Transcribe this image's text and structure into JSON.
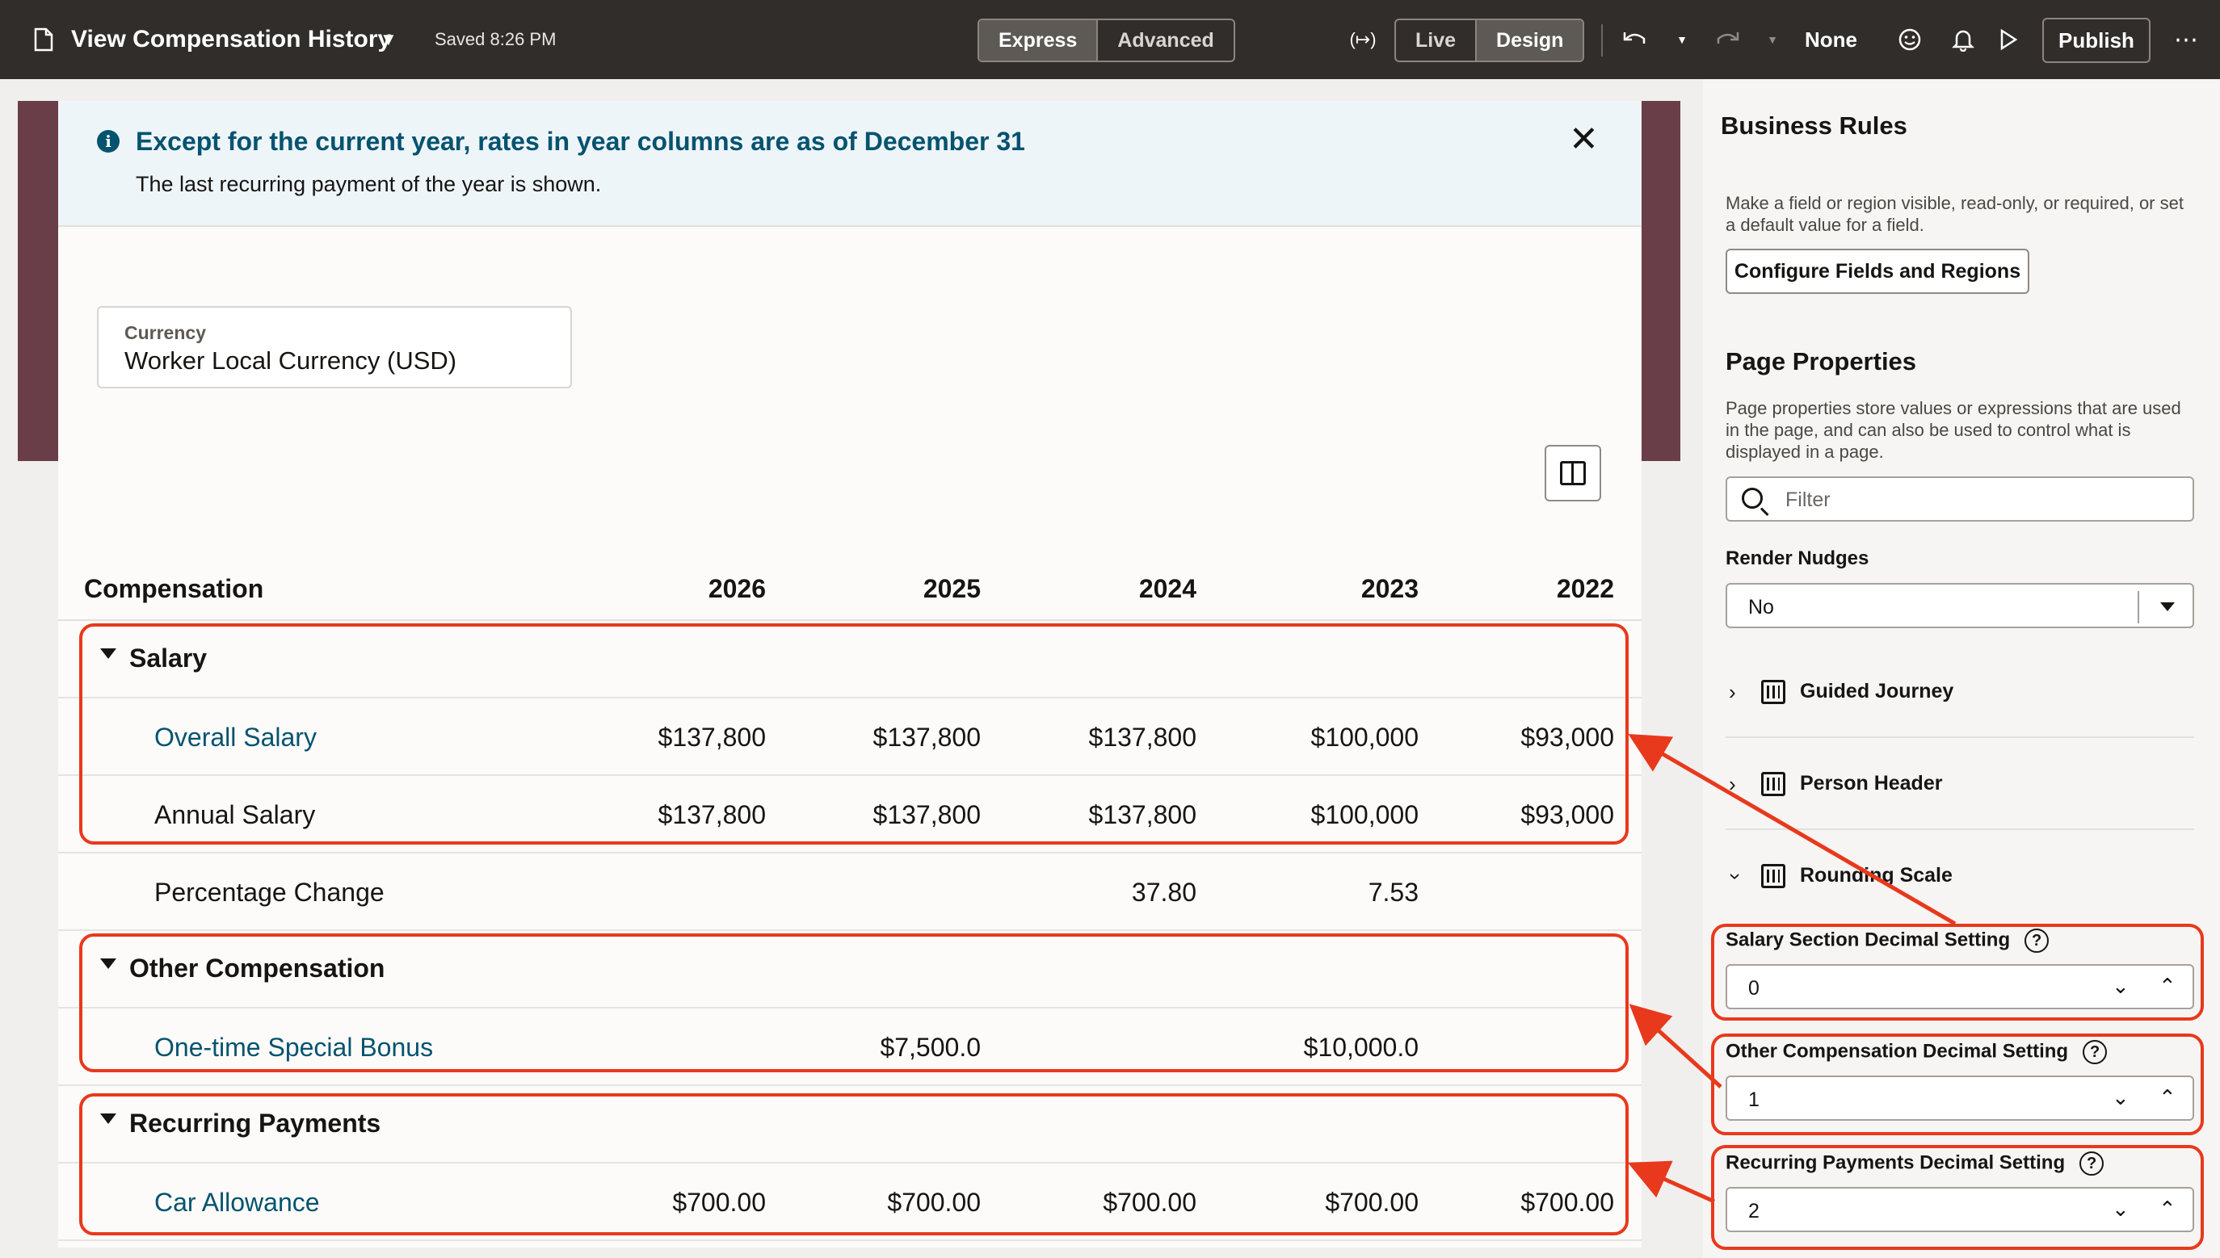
{
  "topbar": {
    "title": "View Compensation History",
    "saved": "Saved 8:26 PM",
    "mode_tabs": [
      "Express",
      "Advanced"
    ],
    "view_tabs": [
      "Live",
      "Design"
    ],
    "variable_icon": "(↦)",
    "none_label": "None",
    "publish_label": "Publish"
  },
  "banner": {
    "title": "Except for the current year, rates in year columns are as of December 31",
    "text": "The last recurring payment of the year is shown."
  },
  "currency": {
    "label": "Currency",
    "value": "Worker Local Currency (USD)"
  },
  "table": {
    "header": [
      "Compensation",
      "2026",
      "2025",
      "2024",
      "2023",
      "2022"
    ],
    "sections": {
      "salary": "Salary",
      "other": "Other Compensation",
      "recurring": "Recurring Payments"
    },
    "rows": {
      "overall_salary": {
        "label": "Overall Salary",
        "values": [
          "$137,800",
          "$137,800",
          "$137,800",
          "$100,000",
          "$93,000"
        ]
      },
      "annual_salary": {
        "label": "Annual Salary",
        "values": [
          "$137,800",
          "$137,800",
          "$137,800",
          "$100,000",
          "$93,000"
        ]
      },
      "percentage_change": {
        "label": "Percentage Change",
        "values": [
          "",
          "",
          "37.80",
          "7.53",
          ""
        ]
      },
      "bonus": {
        "label": "One-time Special Bonus",
        "values": [
          "",
          "$7,500.0",
          "",
          "$10,000.0",
          ""
        ]
      },
      "car_allowance": {
        "label": "Car Allowance",
        "values": [
          "$700.00",
          "$700.00",
          "$700.00",
          "$700.00",
          "$700.00"
        ]
      }
    }
  },
  "panel": {
    "business_rules_title": "Business Rules",
    "business_rules_text": "Make a field or region visible, read-only, or required, or set a default value for a field.",
    "configure_button": "Configure Fields and Regions",
    "page_properties_title": "Page Properties",
    "page_properties_text": "Page properties store values or expressions that are used in the page, and can also be used to control what is displayed in a page.",
    "filter_placeholder": "Filter",
    "render_nudges_label": "Render Nudges",
    "render_nudges_value": "No",
    "tree": [
      "Guided Journey",
      "Person Header",
      "Rounding Scale"
    ],
    "decimals": [
      {
        "label": "Salary Section Decimal Setting",
        "value": "0"
      },
      {
        "label": "Other Compensation Decimal Setting",
        "value": "1"
      },
      {
        "label": "Recurring Payments Decimal Setting",
        "value": "2"
      }
    ]
  },
  "colors": {
    "topbar": "#312d2a",
    "accent": "#04536f",
    "highlight": "#e8391c",
    "brand_band": "#6a3e48"
  }
}
